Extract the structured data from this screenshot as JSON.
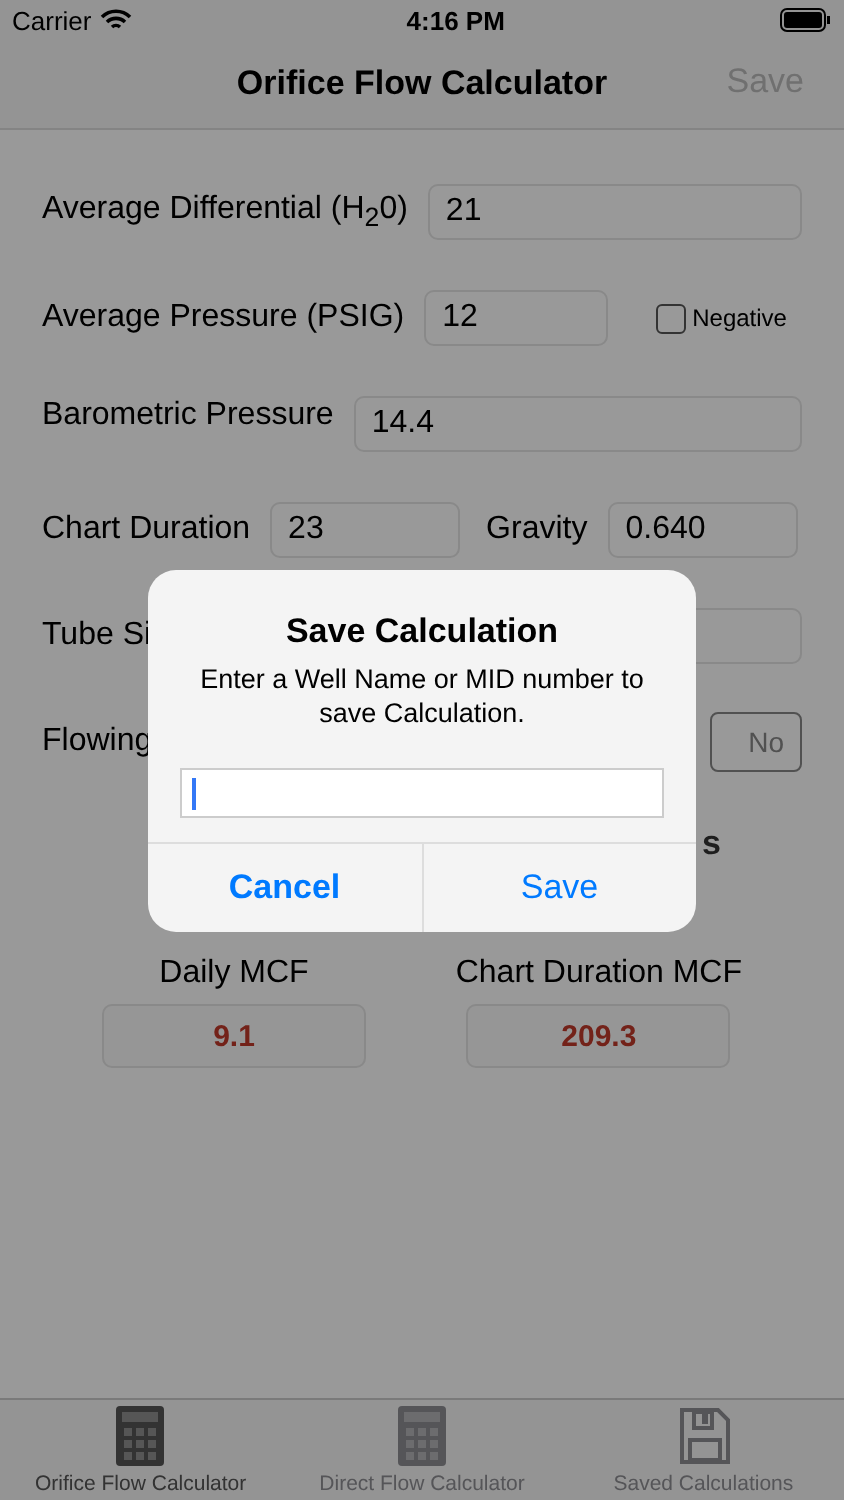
{
  "status_bar": {
    "carrier": "Carrier",
    "time": "4:16 PM"
  },
  "nav_bar": {
    "title": "Orifice Flow Calculator",
    "action": {
      "label": "Save",
      "disabled": true
    }
  },
  "form": {
    "rows": [
      {
        "kind": "field",
        "label": "Average Differential (H$_{2}$0)",
        "value": "21"
      },
      {
        "kind": "field_check",
        "label": "Average Pressure (PSIG)",
        "value": "12",
        "check": {
          "label": "Negative",
          "checked": false
        }
      },
      {
        "kind": "field",
        "label": "Barometric Pressure",
        "value": "14.4"
      },
      {
        "kind": "pair",
        "items": [
          {
            "label": "Chart Duration",
            "value": "23"
          },
          {
            "label": "Gravity",
            "value": "0.640"
          }
        ]
      },
      {
        "kind": "covered",
        "label": "Tube Si"
      },
      {
        "kind": "toggle",
        "label": "Flowing",
        "button": "No"
      }
    ],
    "partial_heading": "s",
    "results": [
      {
        "label": "Daily MCF",
        "value": "9.1"
      },
      {
        "label": "Chart Duration MCF",
        "value": "209.3"
      }
    ]
  },
  "tab_bar": [
    {
      "label": "Orifice Flow Calculator",
      "kind": "calculator",
      "selected": true
    },
    {
      "label": "Direct Flow Calculator",
      "kind": "calculator",
      "selected": false
    },
    {
      "label": "Saved Calculations",
      "kind": "floppy",
      "selected": false
    }
  ],
  "dialog": {
    "title": "Save Calculation",
    "message": "Enter a Well Name or MID number to save Calculation.",
    "input": {
      "focused": true
    },
    "buttons": [
      {
        "label": "Cancel",
        "kind": "cancel"
      },
      {
        "label": "Save",
        "kind": "default"
      }
    ]
  }
}
